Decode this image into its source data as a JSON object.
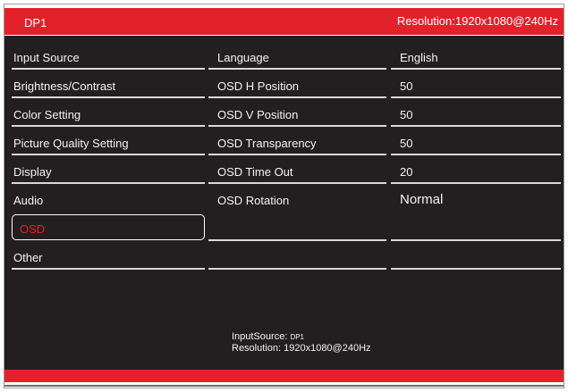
{
  "header": {
    "input": "DP1",
    "resolution": "Resolution:1920x1080@240Hz"
  },
  "menu": [
    {
      "label": "Input Source"
    },
    {
      "label": "Brightness/Contrast"
    },
    {
      "label": "Color Setting"
    },
    {
      "label": "Picture Quality Setting"
    },
    {
      "label": "Display"
    },
    {
      "label": "Audio"
    },
    {
      "label": "OSD",
      "selected": true
    },
    {
      "label": "Other"
    }
  ],
  "osd_settings": [
    {
      "name": "Language",
      "value": "English"
    },
    {
      "name": "OSD H Position",
      "value": "50"
    },
    {
      "name": "OSD V Position",
      "value": "50"
    },
    {
      "name": "OSD Transparency",
      "value": "50"
    },
    {
      "name": "OSD Time Out",
      "value": "20"
    },
    {
      "name": "OSD Rotation",
      "value": "Normal"
    }
  ],
  "footer": {
    "input_label": "InputSource:",
    "input_value": "DP1",
    "resolution_label": "Resolution:",
    "resolution_value": "1920x1080@240Hz"
  },
  "colors": {
    "accent": "#e3212a",
    "panel": "#231f20",
    "text": "#f2f2f2"
  }
}
